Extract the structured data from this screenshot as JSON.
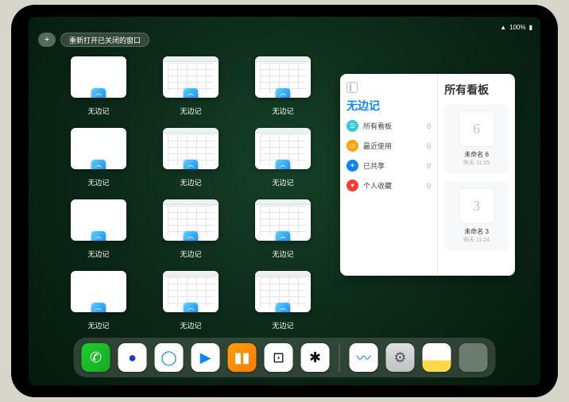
{
  "status": {
    "wifi": "􀙇",
    "battery_pct": "100%"
  },
  "controls": {
    "plus": "+",
    "reopen_label": "重新打开已关闭的窗口"
  },
  "tiles": [
    {
      "label": "无边记",
      "style": "blank"
    },
    {
      "label": "无边记",
      "style": "grid"
    },
    {
      "label": "无边记",
      "style": "grid"
    },
    {
      "label": "无边记",
      "style": "blank"
    },
    {
      "label": "无边记",
      "style": "grid"
    },
    {
      "label": "无边记",
      "style": "grid"
    },
    {
      "label": "无边记",
      "style": "blank"
    },
    {
      "label": "无边记",
      "style": "grid"
    },
    {
      "label": "无边记",
      "style": "grid"
    },
    {
      "label": "无边记",
      "style": "blank"
    },
    {
      "label": "无边记",
      "style": "grid"
    },
    {
      "label": "无边记",
      "style": "grid"
    }
  ],
  "panel": {
    "left_title": "无边记",
    "right_title": "所有看板",
    "rows": [
      {
        "icon_color": "#34c8e0",
        "icon": "☰",
        "label": "所有看板",
        "count": "0"
      },
      {
        "icon_color": "#ff9f0a",
        "icon": "◷",
        "label": "最近使用",
        "count": "0"
      },
      {
        "icon_color": "#0a84ff",
        "icon": "✦",
        "label": "已共享",
        "count": "0"
      },
      {
        "icon_color": "#ff3b30",
        "icon": "♥",
        "label": "个人收藏",
        "count": "0"
      }
    ],
    "cards": [
      {
        "sketch": "6",
        "name": "未命名 6",
        "sub": "昨天 11:25"
      },
      {
        "sketch": "3",
        "name": "未命名 3",
        "sub": "昨天 11:24"
      }
    ]
  },
  "dock": {
    "items": [
      {
        "name": "wechat",
        "bg": "linear-gradient(135deg,#1fce2e,#17a824)",
        "glyph": "✆"
      },
      {
        "name": "quark",
        "bg": "#fff",
        "fg": "#1b3bd1",
        "glyph": "●"
      },
      {
        "name": "qqbrowser",
        "bg": "#fff",
        "fg": "#0a84ff",
        "glyph": "◯"
      },
      {
        "name": "media",
        "bg": "#fff",
        "glyph": "▶",
        "fg": "#0a84ff"
      },
      {
        "name": "books",
        "bg": "linear-gradient(135deg,#ff9f0a,#ff7a00)",
        "glyph": "▮▮"
      },
      {
        "name": "dice",
        "bg": "#fff",
        "fg": "#111",
        "glyph": "⊡"
      },
      {
        "name": "connect",
        "bg": "#fff",
        "fg": "#111",
        "glyph": "✱"
      }
    ],
    "recent": [
      {
        "name": "freeform",
        "bg": "#fff",
        "glyph": "〰",
        "fg": "#0a84ff"
      },
      {
        "name": "settings",
        "bg": "linear-gradient(#dddfe0,#bfc2c3)",
        "glyph": "⚙",
        "fg": "#555"
      },
      {
        "name": "notes",
        "bg": "linear-gradient(#fff 60%,#ffd84c 60%)",
        "glyph": "",
        "fg": "#666"
      }
    ]
  }
}
